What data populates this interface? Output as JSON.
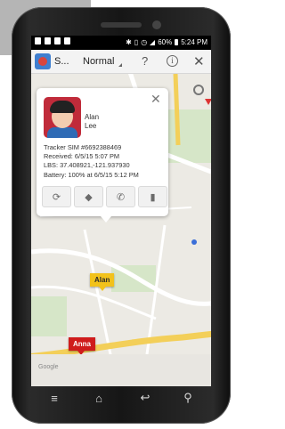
{
  "status": {
    "time": "5:24 PM",
    "battery": "60%"
  },
  "appbar": {
    "title": "S...",
    "mode": "Normal",
    "help": "?",
    "info": "i",
    "close": "✕"
  },
  "popup": {
    "close": "✕",
    "first_name": "Alan",
    "last_name": "Lee",
    "lines": [
      "Tracker SIM #6692388469",
      "Received: 6/5/15 5:07 PM",
      "LBS: 37.408921,-121.937930",
      "Battery: 100% at 6/5/15 5:12 PM"
    ],
    "actions": [
      "refresh-icon",
      "navigate-icon",
      "phone-icon",
      "battery-icon"
    ]
  },
  "markers": [
    {
      "label": "Alan",
      "color": "#f2c21b"
    },
    {
      "label": "Anna",
      "color": "#cf1c1c"
    }
  ],
  "zoom": {
    "in": "+",
    "out": "−"
  },
  "map": {
    "attribution": "Google"
  },
  "colors": {
    "phone_body": "#1a1a1a",
    "accent_blue": "#3b6fd8"
  }
}
